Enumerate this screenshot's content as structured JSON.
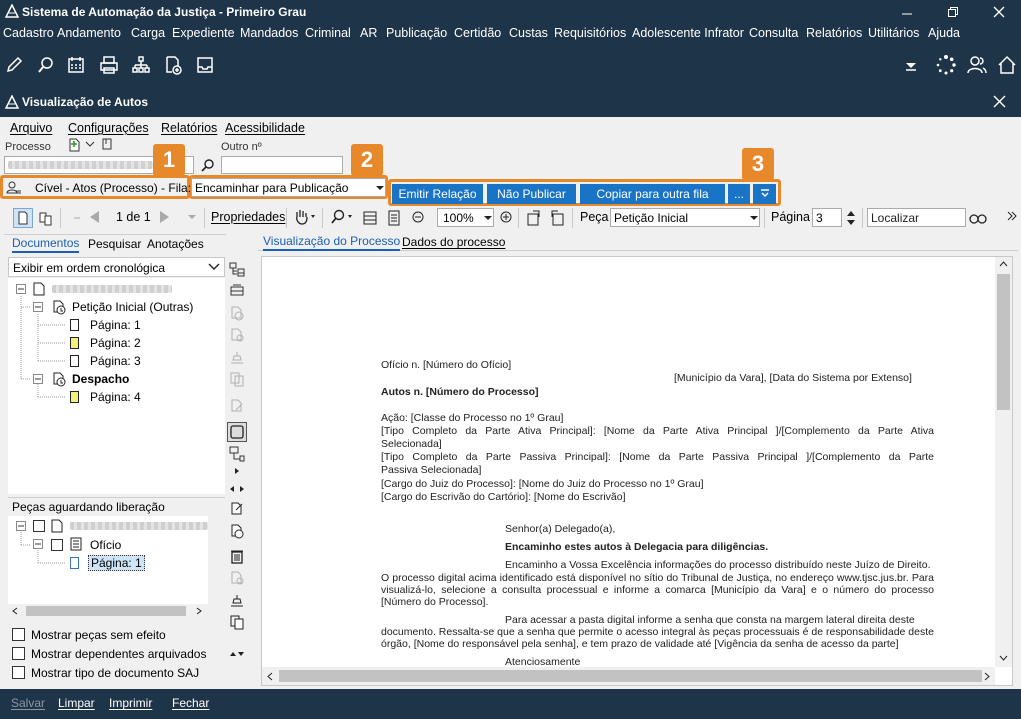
{
  "app": {
    "title": "Sistema de Automação da Justiça - Primeiro Grau",
    "menu": [
      "Cadastro",
      "Andamento",
      "Carga",
      "Expediente",
      "Mandados",
      "Criminal",
      "AR",
      "Publicação",
      "Certidão",
      "Custas",
      "Requisitórios",
      "Adolescente Infrator",
      "Consulta",
      "Relatórios",
      "Utilitários",
      "Ajuda"
    ]
  },
  "window": {
    "title": "Visualização de Autos",
    "menu": [
      "Arquivo",
      "Configurações",
      "Relatórios",
      "Acessibilidade"
    ]
  },
  "form": {
    "processo_label": "Processo",
    "outro_label": "Outro nº",
    "fila_label": "Cível - Atos (Processo) - Fila:",
    "fila_value": "Encaminhar para Publicação",
    "buttons": [
      "Emitir Relação",
      "Não Publicar",
      "Copiar para outra fila",
      "..."
    ],
    "badges": [
      "1",
      "2",
      "3"
    ]
  },
  "toolbar": {
    "page_of": "1 de 1",
    "propriedades": "Propriedades",
    "zoom": "100%",
    "peca_label": "Peça",
    "peca_value": "Petição Inicial",
    "pagina_label": "Página",
    "pagina_value": "3",
    "localizar_placeholder": "Localizar"
  },
  "left": {
    "tabs": [
      "Documentos",
      "Pesquisar",
      "Anotações"
    ],
    "order_select": "Exibir em ordem cronológica",
    "tree": {
      "peticao": "Petição Inicial (Outras)",
      "pages": [
        "Página: 1",
        "Página: 2",
        "Página: 3"
      ],
      "despacho": "Despacho",
      "despacho_page": "Página: 4"
    },
    "awaiting_title": "Peças aguardando liberação",
    "awaiting": {
      "oficio": "Ofício",
      "page": "Página: 1"
    },
    "checks": [
      "Mostrar peças sem efeito",
      "Mostrar dependentes arquivados",
      "Mostrar tipo de documento SAJ"
    ]
  },
  "viewer": {
    "tabs": [
      "Visualização do Processo",
      "Dados do processo"
    ],
    "doc": {
      "l1": "Ofício n. [Número do Ofício]",
      "l2": "[Município da Vara], [Data do Sistema por Extenso]",
      "l3": "Autos n. [Número do Processo]",
      "l4": "Ação: [Classe do Processo no 1º Grau]",
      "l5": "[Tipo Completo da Parte Ativa Principal]: [Nome da Parte Ativa Principal ]/[Complemento da Parte Ativa",
      "l5b": "Selecionada]",
      "l6": "[Tipo Completo da Parte Passiva Principal]: [Nome da Parte Passiva Principal ]/[Complemento da Parte",
      "l6b": "Passiva Selecionada]",
      "l7": "[Cargo do Juiz do Processo]: [Nome do Juiz do Processo no 1º Grau]",
      "l8": "[Cargo do Escrivão do Cartório]: [Nome do Escrivão]",
      "l9": "Senhor(a) Delegado(a),",
      "l10": "Encaminho estes autos à Delegacia para diligências.",
      "p1a": "Encaminho a Vossa Excelência informações do processo distribuído neste Juízo de Direito.",
      "p1b": "O processo digital acima identificado está disponível no sítio do Tribunal de Justiça, no endereço www.tjsc.jus.br. Para",
      "p1c": "visualizá-lo, selecione a consulta processual e informe a comarca  [Município da Vara] e o número do processo",
      "p1d": "[Número do Processo].",
      "p2a": "Para acessar a pasta digital informe a senha que consta na margem lateral direita deste",
      "p2b": "documento. Ressalta-se que a senha que permite o acesso integral às peças processuais é de responsabilidade deste",
      "p2c": "órgão, [Nome do responsável pela senha], e tem prazo de validade até [Vigência da senha de acesso da parte]",
      "l11": "Atenciosamente"
    }
  },
  "status": [
    "Salvar",
    "Limpar",
    "Imprimir",
    "Fechar"
  ]
}
